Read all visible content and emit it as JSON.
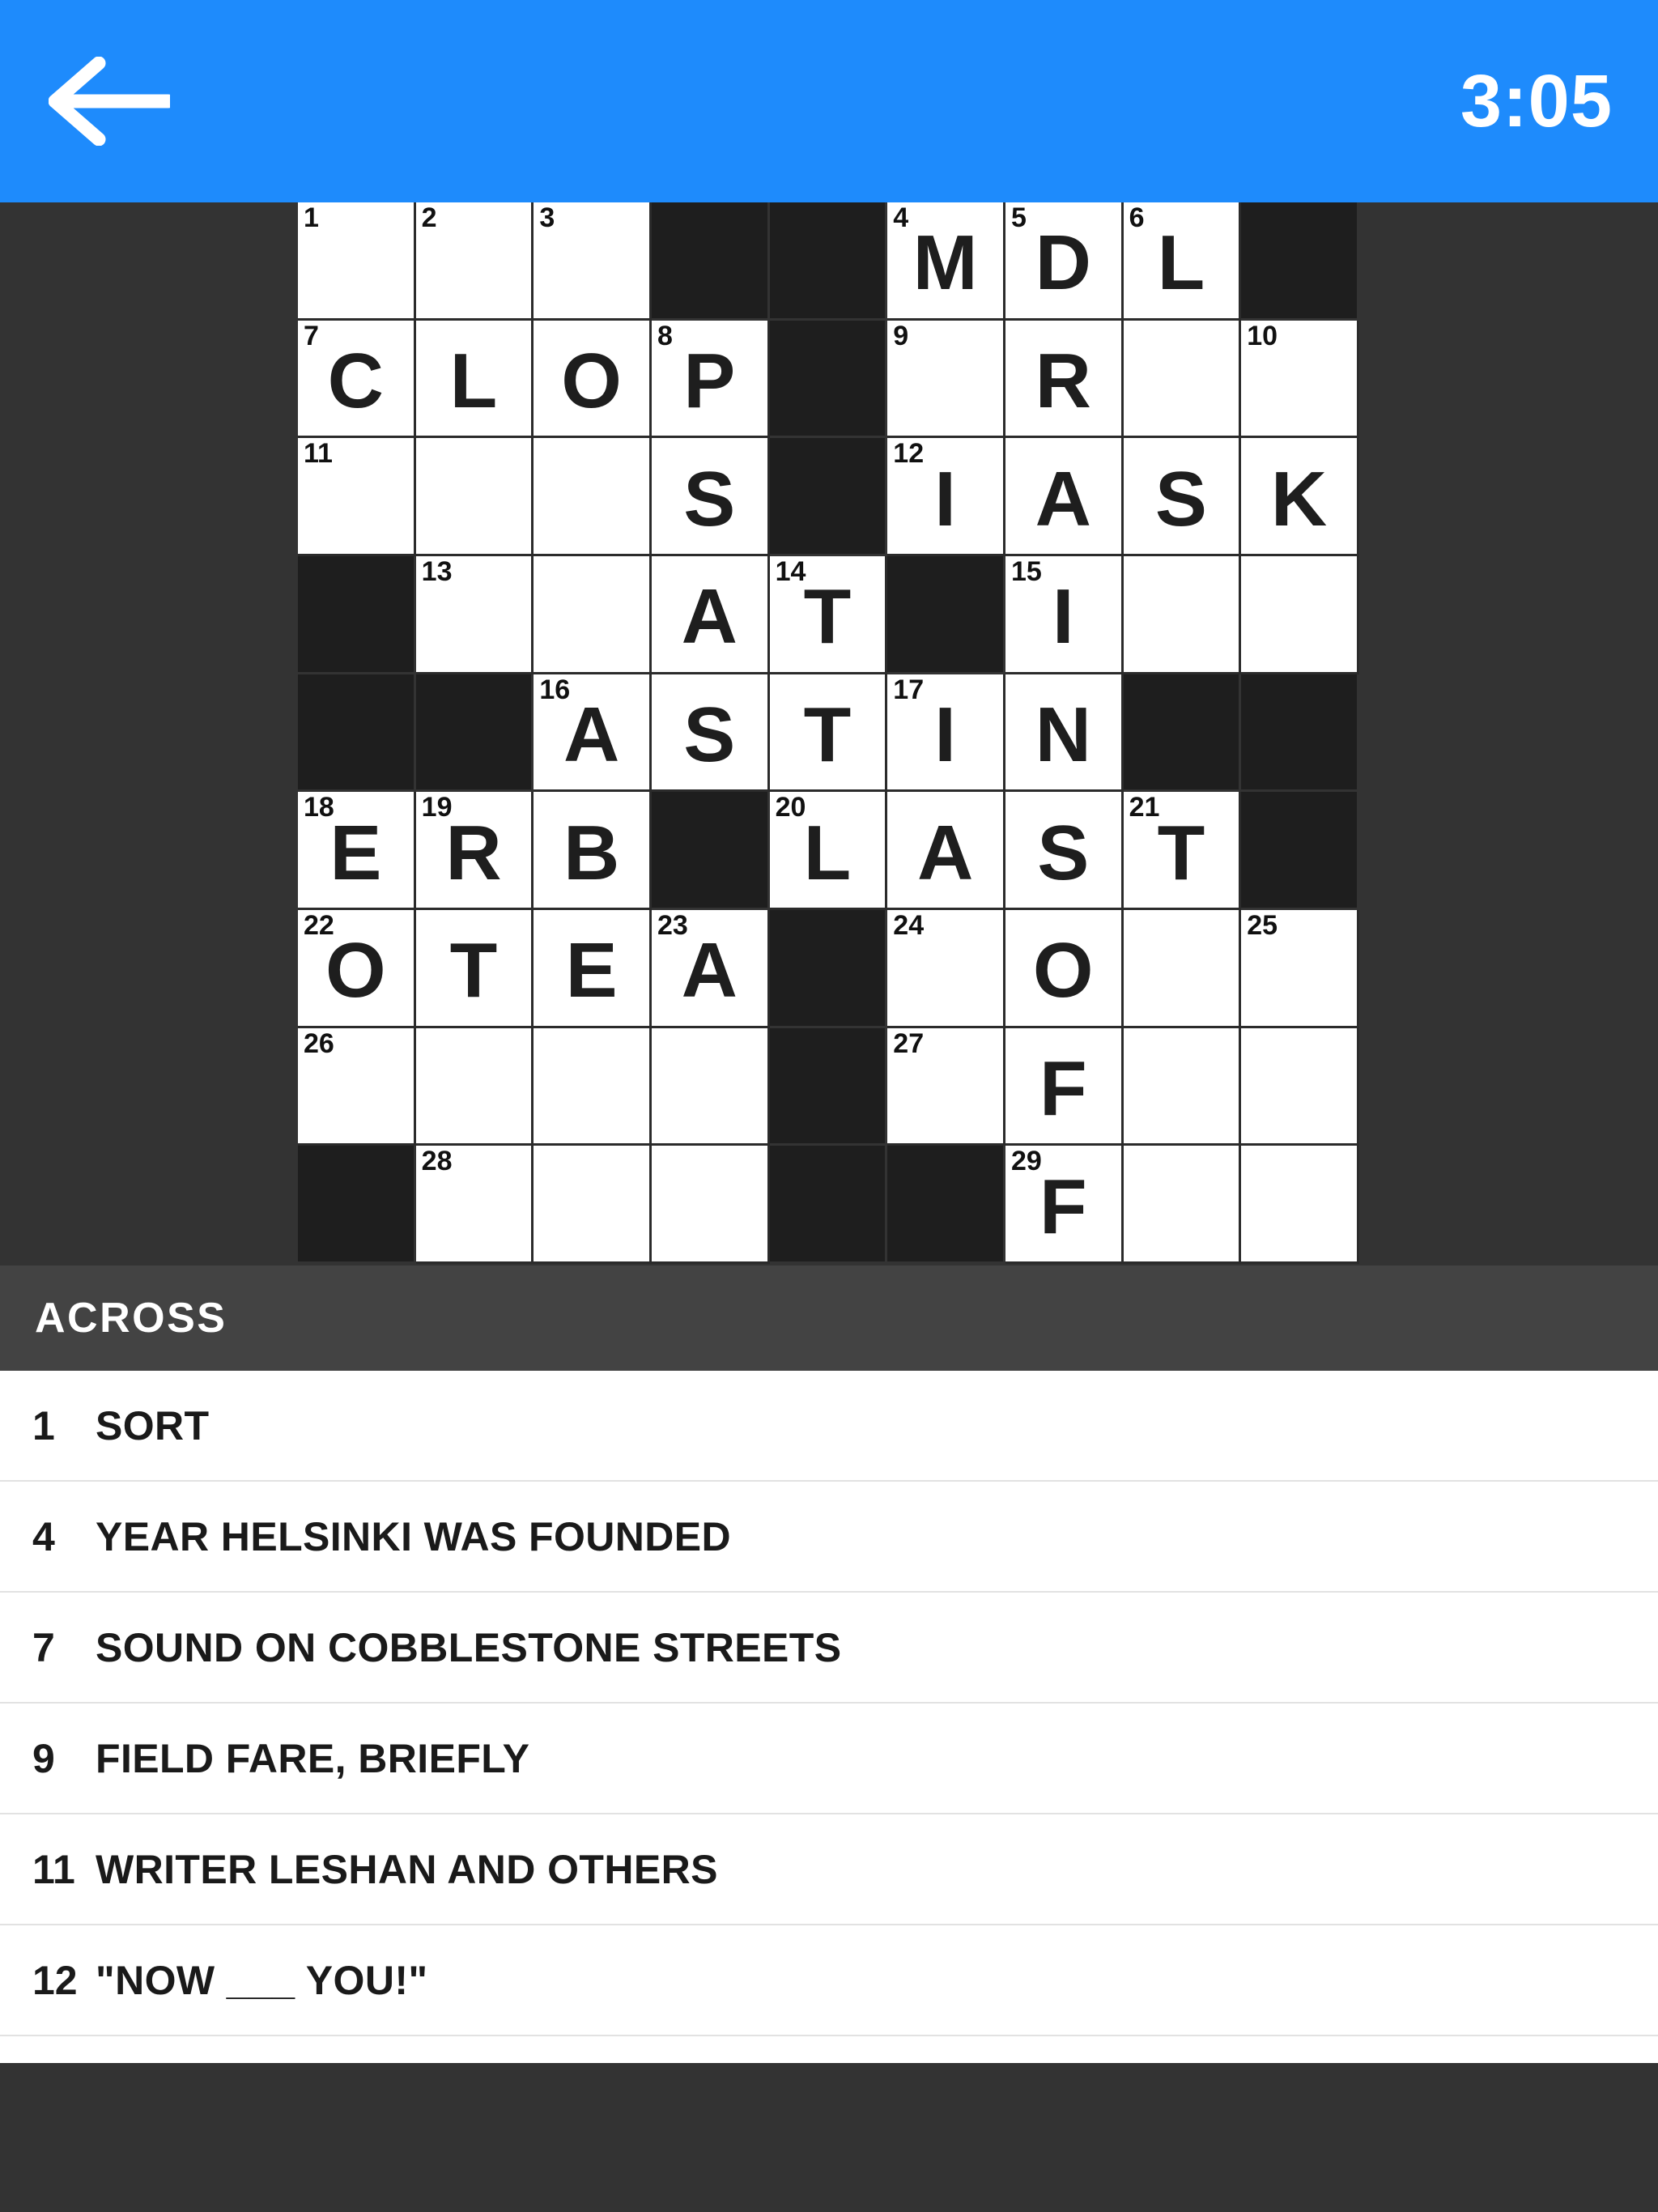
{
  "header": {
    "back_icon": "arrow-left-icon",
    "timer": "3:05",
    "accent_color": "#1e8bfc"
  },
  "theme": {
    "background": "#333333",
    "black_cell": "#1e1e1e",
    "white_cell": "#ffffff",
    "clue_header_bg": "#434343",
    "clue_row_bg": "#ffffff",
    "text_dark": "#1a1a1a"
  },
  "grid": {
    "columns": 9,
    "rows": 9,
    "cells": [
      [
        {
          "type": "white",
          "number": "1",
          "letter": ""
        },
        {
          "type": "white",
          "number": "2",
          "letter": ""
        },
        {
          "type": "white",
          "number": "3",
          "letter": ""
        },
        {
          "type": "black",
          "number": "",
          "letter": ""
        },
        {
          "type": "black",
          "number": "",
          "letter": ""
        },
        {
          "type": "white",
          "number": "4",
          "letter": "M"
        },
        {
          "type": "white",
          "number": "5",
          "letter": "D"
        },
        {
          "type": "white",
          "number": "6",
          "letter": "L"
        },
        {
          "type": "black",
          "number": "",
          "letter": ""
        }
      ],
      [
        {
          "type": "white",
          "number": "7",
          "letter": "C"
        },
        {
          "type": "white",
          "number": "",
          "letter": "L"
        },
        {
          "type": "white",
          "number": "",
          "letter": "O"
        },
        {
          "type": "white",
          "number": "8",
          "letter": "P"
        },
        {
          "type": "black",
          "number": "",
          "letter": ""
        },
        {
          "type": "white",
          "number": "9",
          "letter": ""
        },
        {
          "type": "white",
          "number": "",
          "letter": "R"
        },
        {
          "type": "white",
          "number": "",
          "letter": ""
        },
        {
          "type": "white",
          "number": "10",
          "letter": ""
        }
      ],
      [
        {
          "type": "white",
          "number": "11",
          "letter": ""
        },
        {
          "type": "white",
          "number": "",
          "letter": ""
        },
        {
          "type": "white",
          "number": "",
          "letter": ""
        },
        {
          "type": "white",
          "number": "",
          "letter": "S"
        },
        {
          "type": "black",
          "number": "",
          "letter": ""
        },
        {
          "type": "white",
          "number": "12",
          "letter": "I"
        },
        {
          "type": "white",
          "number": "",
          "letter": "A"
        },
        {
          "type": "white",
          "number": "",
          "letter": "S"
        },
        {
          "type": "white",
          "number": "",
          "letter": "K"
        }
      ],
      [
        {
          "type": "black",
          "number": "",
          "letter": ""
        },
        {
          "type": "white",
          "number": "13",
          "letter": ""
        },
        {
          "type": "white",
          "number": "",
          "letter": ""
        },
        {
          "type": "white",
          "number": "",
          "letter": "A"
        },
        {
          "type": "white",
          "number": "14",
          "letter": "T"
        },
        {
          "type": "black",
          "number": "",
          "letter": ""
        },
        {
          "type": "white",
          "number": "15",
          "letter": "I"
        },
        {
          "type": "white",
          "number": "",
          "letter": ""
        },
        {
          "type": "white",
          "number": "",
          "letter": ""
        }
      ],
      [
        {
          "type": "black",
          "number": "",
          "letter": ""
        },
        {
          "type": "black",
          "number": "",
          "letter": ""
        },
        {
          "type": "white",
          "number": "16",
          "letter": "A"
        },
        {
          "type": "white",
          "number": "",
          "letter": "S"
        },
        {
          "type": "white",
          "number": "",
          "letter": "T"
        },
        {
          "type": "white",
          "number": "17",
          "letter": "I"
        },
        {
          "type": "white",
          "number": "",
          "letter": "N"
        },
        {
          "type": "black",
          "number": "",
          "letter": ""
        },
        {
          "type": "black",
          "number": "",
          "letter": ""
        }
      ],
      [
        {
          "type": "white",
          "number": "18",
          "letter": "E"
        },
        {
          "type": "white",
          "number": "19",
          "letter": "R"
        },
        {
          "type": "white",
          "number": "",
          "letter": "B"
        },
        {
          "type": "black",
          "number": "",
          "letter": ""
        },
        {
          "type": "white",
          "number": "20",
          "letter": "L"
        },
        {
          "type": "white",
          "number": "",
          "letter": "A"
        },
        {
          "type": "white",
          "number": "",
          "letter": "S"
        },
        {
          "type": "white",
          "number": "21",
          "letter": "T"
        },
        {
          "type": "black",
          "number": "",
          "letter": ""
        }
      ],
      [
        {
          "type": "white",
          "number": "22",
          "letter": "O"
        },
        {
          "type": "white",
          "number": "",
          "letter": "T"
        },
        {
          "type": "white",
          "number": "",
          "letter": "E"
        },
        {
          "type": "white",
          "number": "23",
          "letter": "A"
        },
        {
          "type": "black",
          "number": "",
          "letter": ""
        },
        {
          "type": "white",
          "number": "24",
          "letter": ""
        },
        {
          "type": "white",
          "number": "",
          "letter": "O"
        },
        {
          "type": "white",
          "number": "",
          "letter": ""
        },
        {
          "type": "white",
          "number": "25",
          "letter": ""
        }
      ],
      [
        {
          "type": "white",
          "number": "26",
          "letter": ""
        },
        {
          "type": "white",
          "number": "",
          "letter": ""
        },
        {
          "type": "white",
          "number": "",
          "letter": ""
        },
        {
          "type": "white",
          "number": "",
          "letter": ""
        },
        {
          "type": "black",
          "number": "",
          "letter": ""
        },
        {
          "type": "white",
          "number": "27",
          "letter": ""
        },
        {
          "type": "white",
          "number": "",
          "letter": "F"
        },
        {
          "type": "white",
          "number": "",
          "letter": ""
        },
        {
          "type": "white",
          "number": "",
          "letter": ""
        }
      ],
      [
        {
          "type": "black",
          "number": "",
          "letter": ""
        },
        {
          "type": "white",
          "number": "28",
          "letter": ""
        },
        {
          "type": "white",
          "number": "",
          "letter": ""
        },
        {
          "type": "white",
          "number": "",
          "letter": ""
        },
        {
          "type": "black",
          "number": "",
          "letter": ""
        },
        {
          "type": "black",
          "number": "",
          "letter": ""
        },
        {
          "type": "white",
          "number": "29",
          "letter": "F"
        },
        {
          "type": "white",
          "number": "",
          "letter": ""
        },
        {
          "type": "white",
          "number": "",
          "letter": ""
        }
      ]
    ]
  },
  "clues": {
    "section_label": "ACROSS",
    "items": [
      {
        "number": "1",
        "text": "SORT"
      },
      {
        "number": "4",
        "text": "YEAR HELSINKI WAS FOUNDED"
      },
      {
        "number": "7",
        "text": "SOUND ON COBBLESTONE STREETS"
      },
      {
        "number": "9",
        "text": "FIELD FARE, BRIEFLY"
      },
      {
        "number": "11",
        "text": "WRITER LESHAN AND OTHERS"
      },
      {
        "number": "12",
        "text": "\"NOW ___ YOU!\""
      }
    ]
  }
}
